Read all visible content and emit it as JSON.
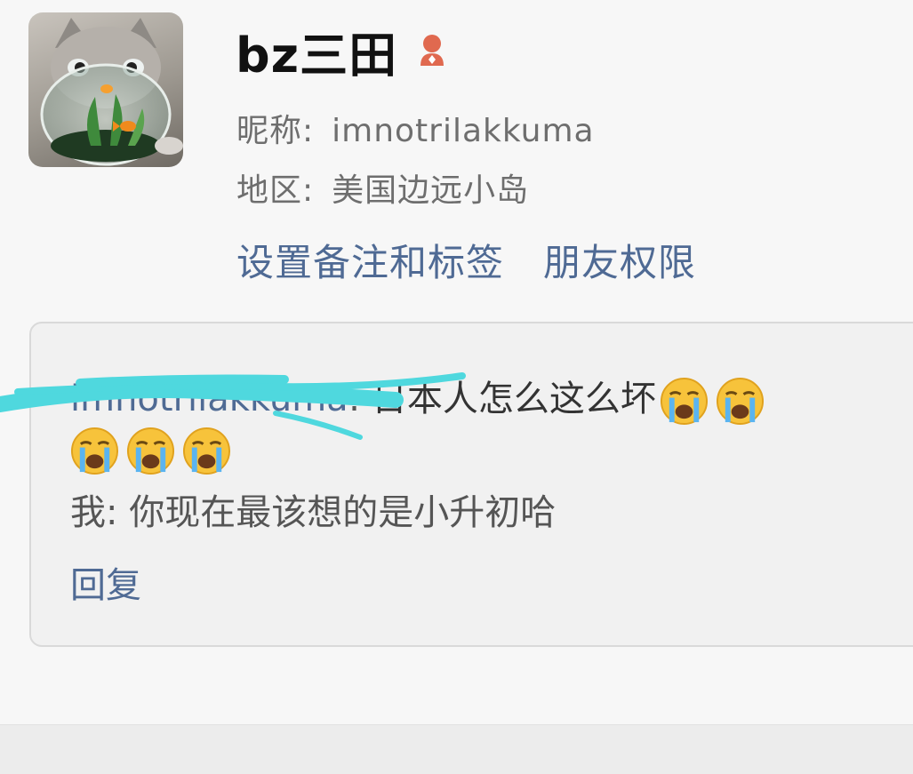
{
  "profile": {
    "display_name": "bz三田",
    "gender_icon": "female-person-icon",
    "nickname_label": "昵称:",
    "nickname_value": "imnotrilakkuma",
    "region_label": "地区:",
    "region_value": "美国边远小岛",
    "accent_color": "#4f6a94"
  },
  "actions": {
    "set_remark_label": "设置备注和标签",
    "friend_permission_label": "朋友权限"
  },
  "message": {
    "sender": "imnotrilakkuma",
    "text": "日本人怎么这么坏",
    "emoji": "loudly-crying-face-icon",
    "reply_text": "我: 你现在最该想的是小升初哈",
    "reply_button_label": "回复"
  }
}
